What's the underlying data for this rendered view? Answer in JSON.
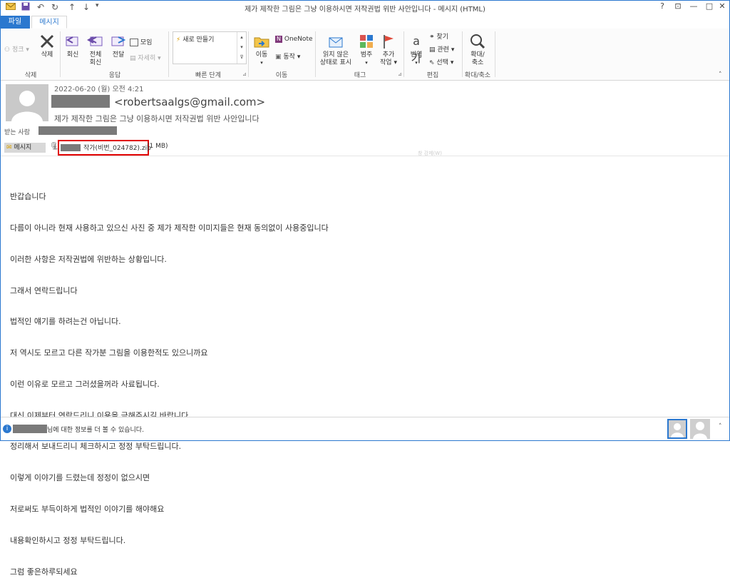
{
  "window": {
    "title": "제가 제작한 그림은 그냥 이용하시면 저작권법 위반 사안입니다 - 메시지 (HTML)",
    "controls": [
      "?",
      "⊡",
      "—",
      "□",
      "✕"
    ]
  },
  "tabs": {
    "file": "파일",
    "message": "메시지"
  },
  "ribbon": {
    "junk": "정크",
    "delete": "삭제",
    "group_delete": "삭제",
    "reply": "회신",
    "reply_all_1": "전체",
    "reply_all_2": "회신",
    "forward": "전달",
    "meeting": "모임",
    "more": "자세히",
    "group_respond": "응답",
    "quick_new": "새로 만들기",
    "group_quick": "빠른 단계",
    "move": "이동",
    "onenote": "OneNote",
    "actions": "동작",
    "group_move": "이동",
    "mark_unread_1": "읽지 않은",
    "mark_unread_2": "상태로 표시",
    "categorize": "범주",
    "followup_1": "추가",
    "followup_2": "작업",
    "group_tags": "태그",
    "translate": "번역",
    "find": "찾기",
    "related": "관련",
    "select": "선택",
    "group_edit": "편집",
    "zoom_1": "확대/",
    "zoom_2": "축소",
    "group_zoom": "확대/축소"
  },
  "message": {
    "date": "2022-06-20 (월) 오전 4:21",
    "sender_email": "<robertsaalgs@gmail.com>",
    "subject": "제가 제작한 그림은 그냥 이용하시면 저작권법 위반 사안입니다",
    "to_label": "받는 사람",
    "tab_message": "메시지",
    "attachment_name": "작가(비번_024782).zip",
    "attachment_size": "(1 MB)",
    "faint_hint": "창 강제(W)",
    "body_lines": [
      "반갑습니다",
      "다름이 아니라 현재 사용하고 있으신 사진 중 제가 제작한 이미지들은 현재 동의없이 사용중입니다",
      "이러한 사항은 저작권법에 위반하는 상황입니다.",
      "그래서 연락드립니다",
      "법적인 얘기를 하려는건 아닙니다.",
      "저 역시도 모르고 다른 작가분 그림을 이용한적도 있으니까요",
      "이런 이유로 모르고 그러셨을꺼라 사료됩니다.",
      "대신 이제부터 연락드리니 이용을 금해주시길 바랍니다.",
      "정리해서 보내드리니 체크하시고 정정 부탁드립니다.",
      "이렇게 이야기를 드렸는데 정정이 없으시면",
      "저로써도 부득이하게 법적인 이야기를 해야해요",
      "내용확인하시고 정정 부탁드립니다.",
      "그럼 좋은하루되세요"
    ]
  },
  "status": {
    "info_text": "님에 대한 정보를 더 볼 수 있습니다."
  },
  "colors": {
    "accent": "#2b78cf",
    "highlight_border": "#e00000",
    "redaction": "#7a7a7a"
  }
}
